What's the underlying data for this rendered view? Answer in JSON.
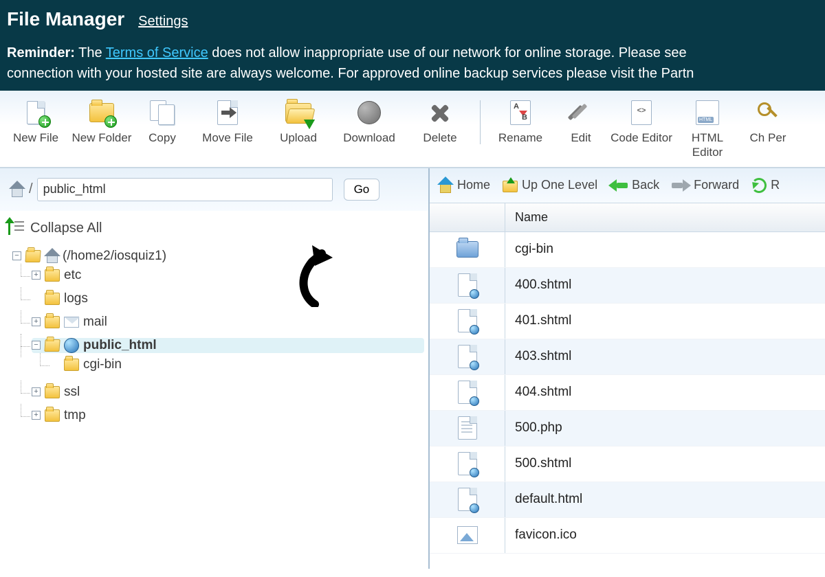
{
  "header": {
    "title": "File Manager",
    "settings": "Settings",
    "reminder_label": "Reminder:",
    "reminder_line1_a": " The ",
    "tos": "Terms of Service",
    "reminder_line1_b": " does not allow inappropriate use of our network for online storage. Please see ",
    "reminder_line2": "connection with your hosted site are always welcome. For approved online backup services please visit the Partn"
  },
  "toolbar": {
    "items": [
      {
        "label": "New File"
      },
      {
        "label": "New Folder"
      },
      {
        "label": "Copy"
      },
      {
        "label": "Move File"
      },
      {
        "label": "Upload"
      },
      {
        "label": "Download"
      },
      {
        "label": "Delete"
      },
      {
        "label": "Rename"
      },
      {
        "label": "Edit"
      },
      {
        "label": "Code Editor"
      },
      {
        "label": "HTML Editor"
      },
      {
        "label": "Ch Per"
      }
    ]
  },
  "path": {
    "value": "public_html",
    "go": "Go"
  },
  "collapse_all": "Collapse All",
  "tree": {
    "root_label": "(/home2/iosquiz1)",
    "items": {
      "etc": "etc",
      "logs": "logs",
      "mail": "mail",
      "public_html": "public_html",
      "cgi_bin": "cgi-bin",
      "ssl": "ssl",
      "tmp": "tmp"
    }
  },
  "navbar": {
    "home": "Home",
    "up": "Up One Level",
    "back": "Back",
    "forward": "Forward",
    "reload": "R"
  },
  "table": {
    "columns": {
      "name": "Name"
    },
    "rows": [
      {
        "name": "cgi-bin",
        "type": "folder"
      },
      {
        "name": "400.shtml",
        "type": "web"
      },
      {
        "name": "401.shtml",
        "type": "web"
      },
      {
        "name": "403.shtml",
        "type": "web"
      },
      {
        "name": "404.shtml",
        "type": "web"
      },
      {
        "name": "500.php",
        "type": "plain"
      },
      {
        "name": "500.shtml",
        "type": "web"
      },
      {
        "name": "default.html",
        "type": "web"
      },
      {
        "name": "favicon.ico",
        "type": "image"
      }
    ]
  }
}
